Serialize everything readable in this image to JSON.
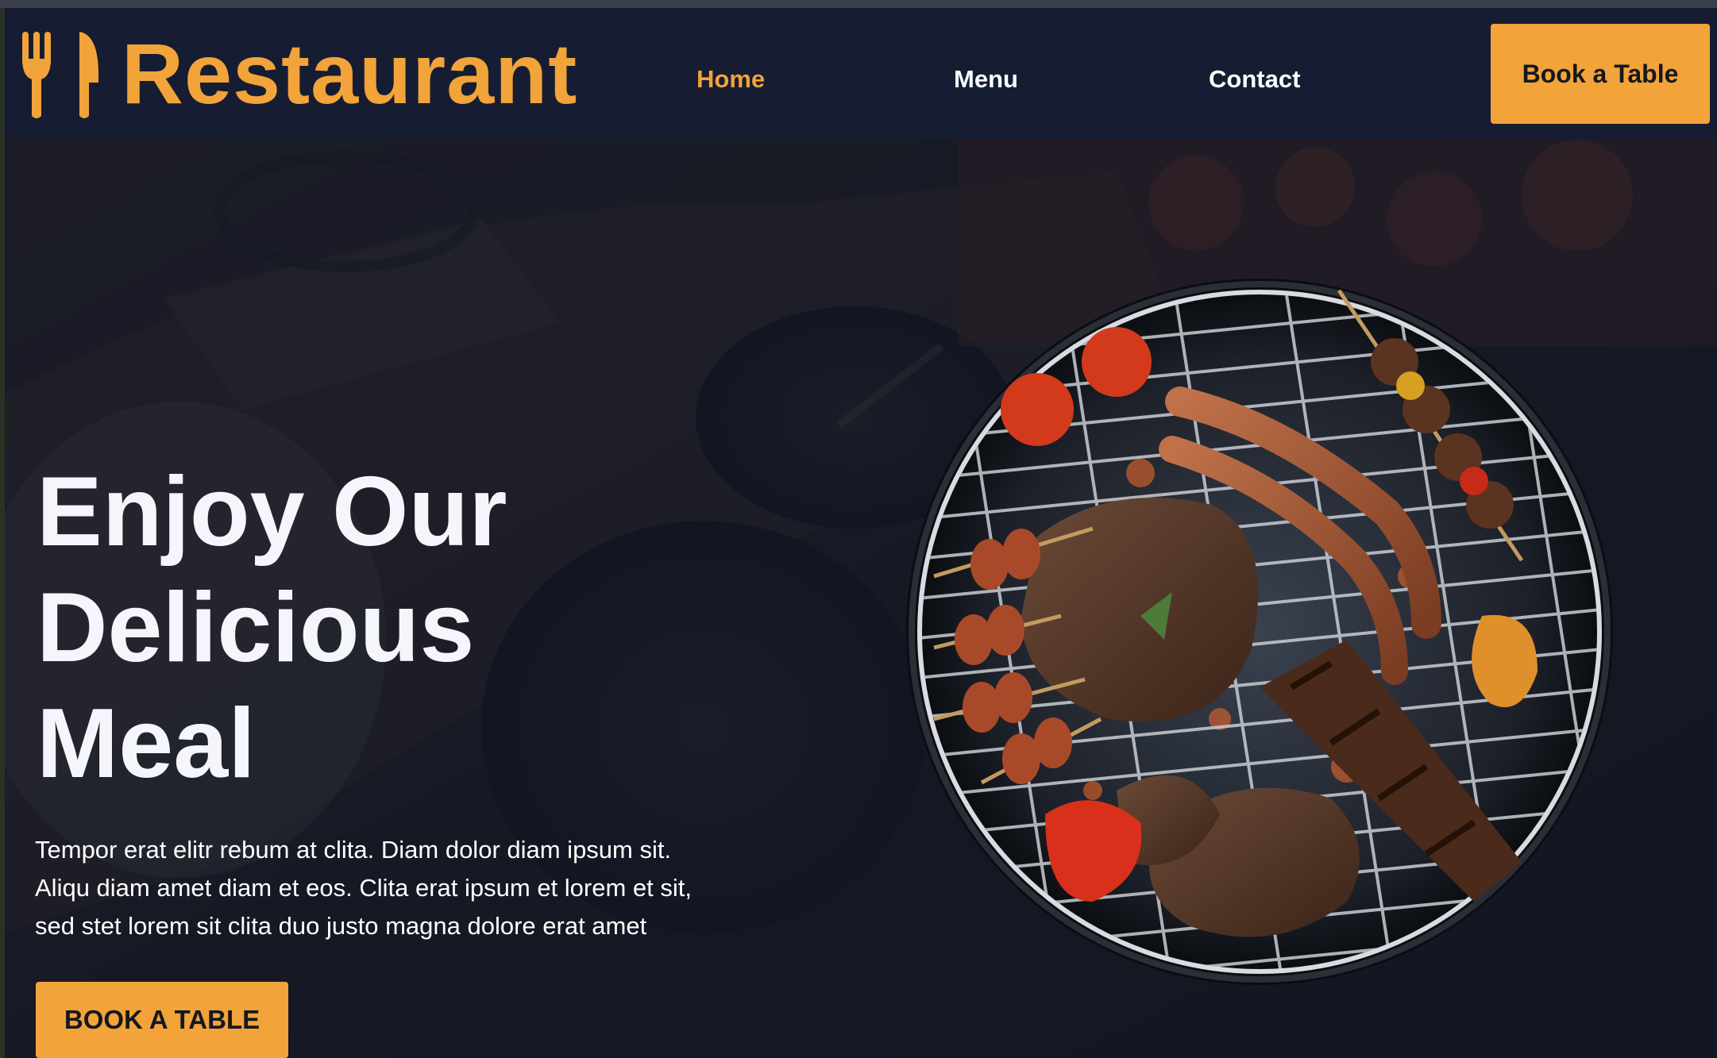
{
  "brand": {
    "name": "Restaurant",
    "icon": "utensils-icon"
  },
  "nav": {
    "items": [
      {
        "label": "Home",
        "active": true
      },
      {
        "label": "Menu",
        "active": false
      },
      {
        "label": "Contact",
        "active": false
      }
    ],
    "cta_label": "Book a Table"
  },
  "hero": {
    "title_line1": "Enjoy Our",
    "title_line2": "Delicious",
    "title_line3": "Meal",
    "text_line1": "Tempor erat elitr rebum at clita. Diam dolor diam ipsum sit.",
    "text_line2": "Aliqu diam amet diam et eos. Clita erat ipsum et lorem et sit,",
    "text_line3": "sed stet lorem sit clita duo justo magna dolore erat amet",
    "cta_label": "BOOK A TABLE",
    "image": "grilled-meat-on-round-grill"
  },
  "colors": {
    "accent": "#f2a33a",
    "navbar": "#161d32",
    "overlay": "#0f172b",
    "heading": "#f4f6fb"
  }
}
